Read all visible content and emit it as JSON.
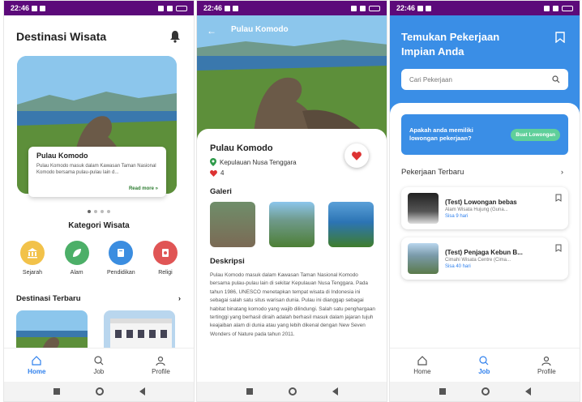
{
  "status": {
    "time": "22:46"
  },
  "screen1": {
    "title": "Destinasi Wisata",
    "hero": {
      "title": "Pulau Komodo",
      "desc": "Pulau Komodo masuk dalam Kawasan Taman Nasional Komodo bersama pulau-pulau lain d...",
      "more": "Read more"
    },
    "kategori_title": "Kategori Wisata",
    "kategori": [
      {
        "label": "Sejarah",
        "color": "#f2c24a"
      },
      {
        "label": "Alam",
        "color": "#4caf68"
      },
      {
        "label": "Pendidikan",
        "color": "#3b8de0"
      },
      {
        "label": "Religi",
        "color": "#e05555"
      }
    ],
    "section": "Destinasi Terbaru",
    "nav": {
      "home": "Home",
      "job": "Job",
      "profile": "Profile"
    }
  },
  "screen2": {
    "bar_title": "Pulau Komodo",
    "name": "Pulau Komodo",
    "location": "Kepulauan Nusa Tenggara",
    "likes": "4",
    "galeri": "Galeri",
    "deskripsi": "Deskripsi",
    "desc": "Pulau Komodo masuk dalam Kawasan Taman Nasional Komodo bersama pulau-pulau lain di sekitar Kepulauan Nusa Tenggara. Pada tahun 1986, UNESCO menetapkan tempat wisata di Indonesia ini sebagai salah satu situs warisan dunia. Pulau ini dianggap sebagai habitat binatang komodo yang wajib dilindungi. Salah satu penghargaan tertinggi yang berhasil diraih adalah berhasil masuk dalam jajaran tujuh keajaiban alam di dunia atau yang lebih dikenal dengan New Seven Wonders of Nature pada tahun 2011."
  },
  "screen3": {
    "title": "Temukan Pekerjaan Impian Anda",
    "search_placeholder": "Cari Pekerjaan",
    "promo_text": "Apakah anda memiliki lowongan pekerjaan?",
    "promo_btn": "Buat Lowongan",
    "section": "Pekerjaan Terbaru",
    "jobs": [
      {
        "title": "(Test) Lowongan bebas",
        "sub": "Alam Wisata Hujung (Guna...",
        "time": "Sisa 9 hari"
      },
      {
        "title": "(Test) Penjaga Kebun B...",
        "sub": "Cimahi Wisata Centre (Cima...",
        "time": "Sisa 40 hari"
      }
    ],
    "nav": {
      "home": "Home",
      "job": "Job",
      "profile": "Profile"
    }
  }
}
